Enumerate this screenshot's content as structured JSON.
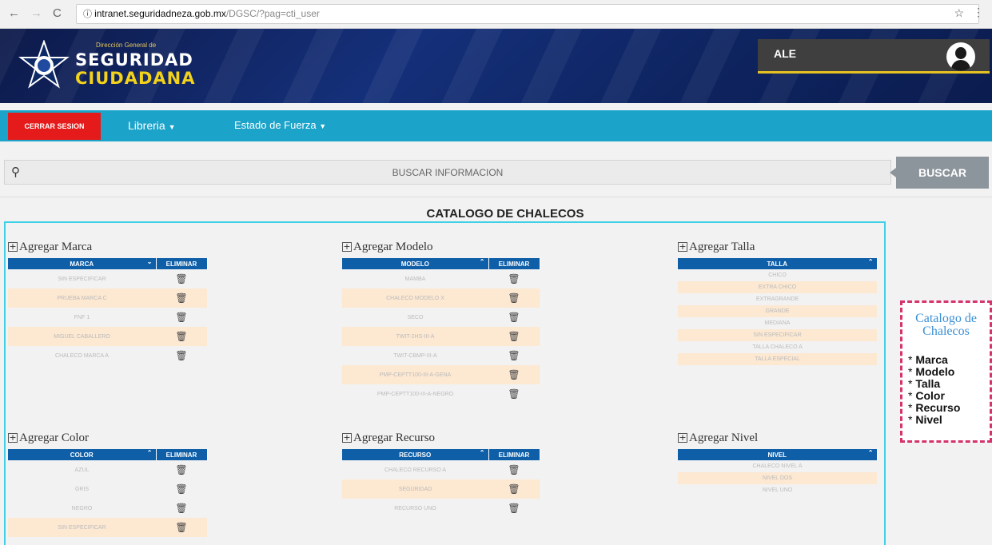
{
  "browser": {
    "url_host": "intranet.seguridadneza.gob.mx",
    "url_path": "/DGSC/?pag=cti_user"
  },
  "header": {
    "logo_small": "Dirección General de",
    "logo_line1": "SEGURIDAD",
    "logo_line2": "CIUDADANA",
    "user_name": "ALE"
  },
  "menu": {
    "logout": "CERRAR SESION",
    "libreria": "Libreria",
    "estado": "Estado de Fuerza"
  },
  "search": {
    "placeholder": "BUSCAR INFORMACION",
    "button": "BUSCAR"
  },
  "title": "CATALOGO DE CHALECOS",
  "sections": {
    "marca": {
      "title": "Agregar Marca",
      "col": "MARCA",
      "del": "ELIMINAR",
      "rows": [
        "SIN ESPECIFICAR",
        "PRUEBA MARCA C",
        "FNF 1",
        "MIGUEL CABALLERO",
        "CHALECO MARCA A"
      ]
    },
    "modelo": {
      "title": "Agregar Modelo",
      "col": "MODELO",
      "del": "ELIMINAR",
      "rows": [
        "MAMBA",
        "CHALECO MODELO X",
        "SECO",
        "TWIT-2HS-III-A",
        "TWIT-CBMP-III-A",
        "PMP-CEPTT100-III-A-GENA",
        "PMP-CEPTT100-III-A-NEGRO"
      ]
    },
    "talla": {
      "title": "Agregar Talla",
      "col": "TALLA",
      "rows": [
        "CHICO",
        "EXTRA CHICO",
        "EXTRAGRANDE",
        "GRANDE",
        "MEDIANA",
        "SIN ESPECIFICAR",
        "TALLA CHALECO A",
        "TALLA ESPECIAL"
      ]
    },
    "color": {
      "title": "Agregar Color",
      "col": "COLOR",
      "del": "ELIMINAR",
      "rows": [
        "AZUL",
        "GRIS",
        "NEGRO",
        "SIN ESPECIFICAR"
      ]
    },
    "recurso": {
      "title": "Agregar Recurso",
      "col": "RECURSO",
      "del": "ELIMINAR",
      "rows": [
        "CHALECO RECURSO A",
        "SEGURIDAD",
        "RECURSO UNO"
      ]
    },
    "nivel": {
      "title": "Agregar Nivel",
      "col": "NIVEL",
      "rows": [
        "CHALECO NIVEL A",
        "NIVEL DOS",
        "NIVEL UNO"
      ]
    }
  },
  "callout": {
    "title": "Catalogo de Chalecos",
    "items": [
      "Marca",
      "Modelo",
      "Talla",
      "Color",
      "Recurso",
      "Nivel"
    ]
  }
}
